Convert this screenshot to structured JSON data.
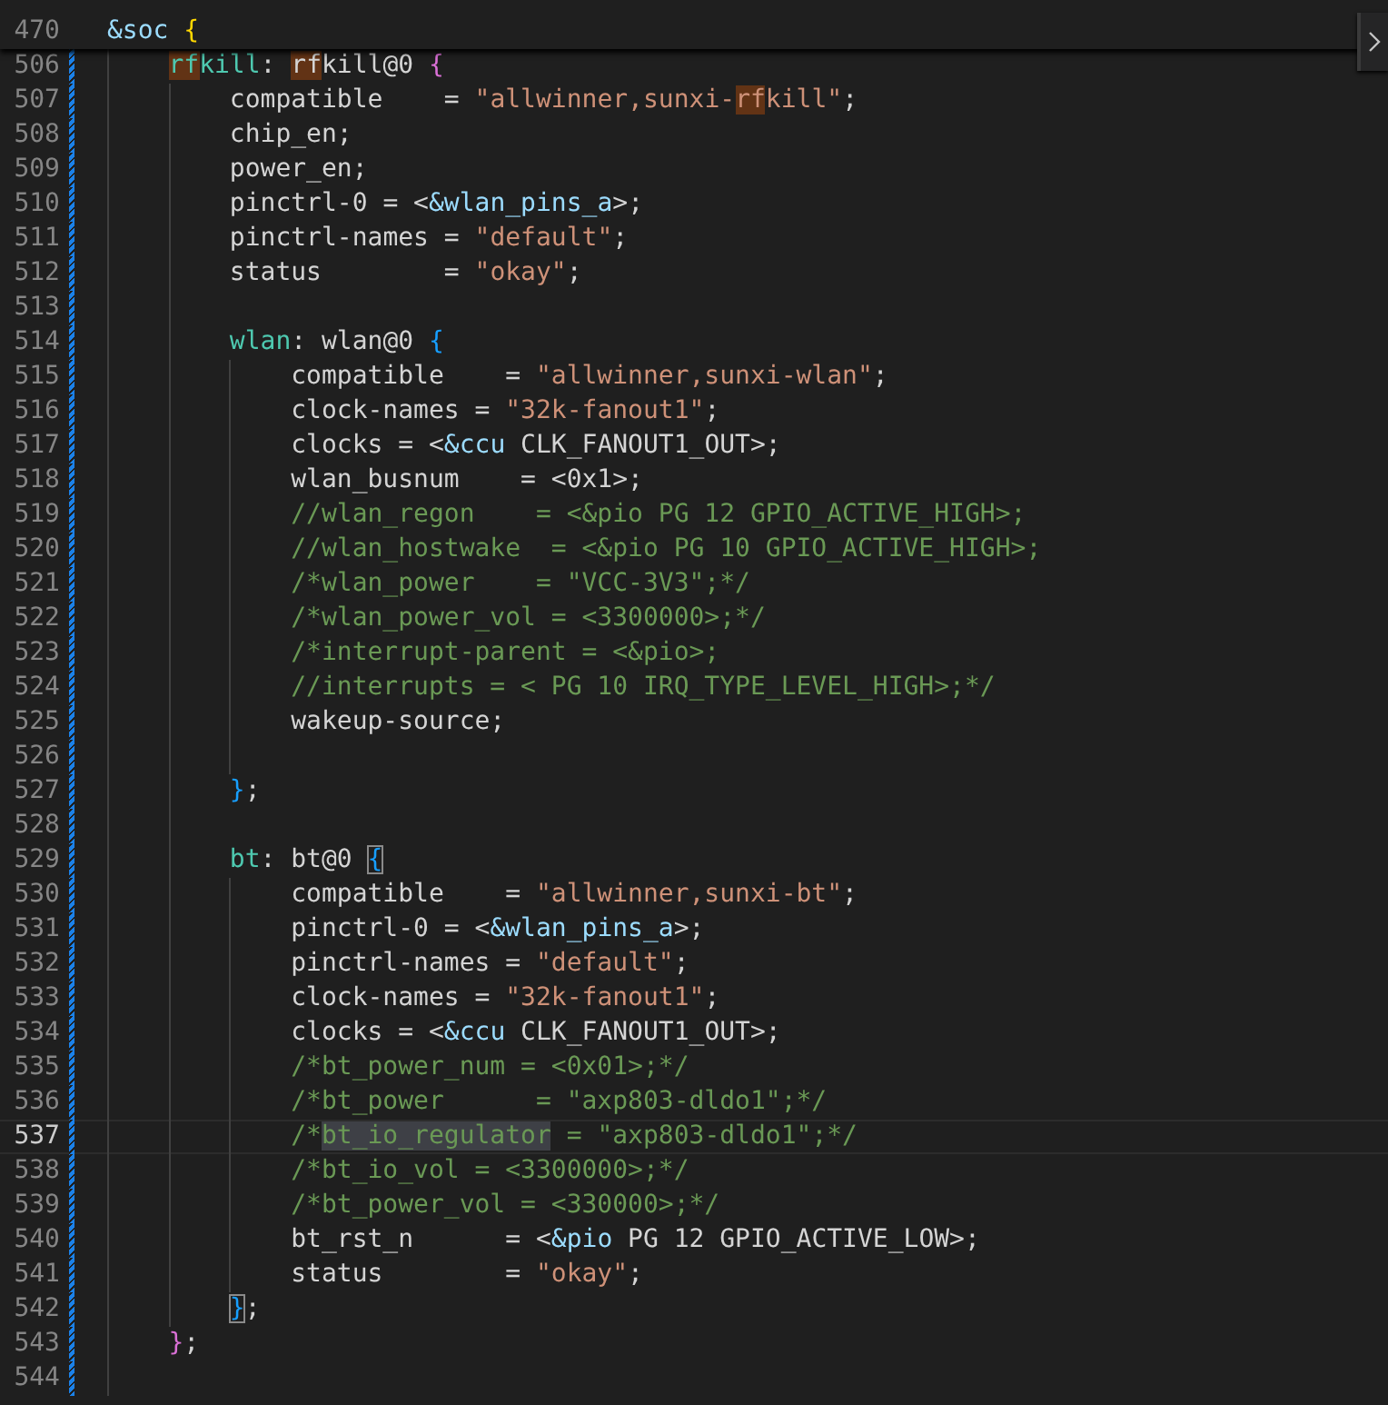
{
  "sticky_scroll": {
    "number": "470",
    "tokens": [
      {
        "text": "&soc ",
        "kind": "ref"
      },
      {
        "text": "{",
        "kind": "bracket",
        "color": "#ffd700"
      }
    ],
    "children": [
      {
        "number": "506",
        "modified": true,
        "tokens": [
          {
            "text": "rf",
            "kind": "label",
            "highlighted": true
          },
          {
            "text": "kill",
            "kind": "label"
          },
          {
            "text": ": ",
            "kind": "plain"
          },
          {
            "text": "rf",
            "kind": "plain",
            "highlighted": true
          },
          {
            "text": "kill@0 ",
            "kind": "plain"
          },
          {
            "text": "{",
            "kind": "bracket",
            "color": "#da70d6"
          }
        ],
        "children": [
          {
            "number": "507",
            "modified": true,
            "tokens": [
              {
                "text": "compatible    = ",
                "kind": "plain"
              },
              {
                "text": "\"allwinner,sunxi-",
                "kind": "string"
              },
              {
                "text": "rf",
                "kind": "string",
                "highlighted": true
              },
              {
                "text": "kill\"",
                "kind": "string"
              },
              {
                "text": ";",
                "kind": "plain"
              }
            ]
          },
          {
            "number": "508",
            "modified": true,
            "tokens": [
              {
                "text": "chip_en;",
                "kind": "plain"
              }
            ]
          },
          {
            "number": "509",
            "modified": true,
            "tokens": [
              {
                "text": "power_en;",
                "kind": "plain"
              }
            ]
          },
          {
            "number": "510",
            "modified": true,
            "tokens": [
              {
                "text": "pinctrl-0 = <",
                "kind": "plain"
              },
              {
                "text": "&wlan_pins_a",
                "kind": "ref"
              },
              {
                "text": ">;",
                "kind": "plain"
              }
            ]
          },
          {
            "number": "511",
            "modified": true,
            "tokens": [
              {
                "text": "pinctrl-names = ",
                "kind": "plain"
              },
              {
                "text": "\"default\"",
                "kind": "string"
              },
              {
                "text": ";",
                "kind": "plain"
              }
            ]
          },
          {
            "number": "512",
            "modified": true,
            "tokens": [
              {
                "text": "status        = ",
                "kind": "plain"
              },
              {
                "text": "\"okay\"",
                "kind": "string"
              },
              {
                "text": ";",
                "kind": "plain"
              }
            ]
          },
          {
            "number": "513",
            "modified": true
          },
          {
            "number": "514",
            "modified": true,
            "tokens": [
              {
                "text": "wlan",
                "kind": "label"
              },
              {
                "text": ": wlan@0 ",
                "kind": "plain"
              },
              {
                "text": "{",
                "kind": "bracket",
                "color": "#179fff"
              }
            ],
            "children": [
              {
                "number": "515",
                "modified": true,
                "tokens": [
                  {
                    "text": "compatible    = ",
                    "kind": "plain"
                  },
                  {
                    "text": "\"allwinner,sunxi-wlan\"",
                    "kind": "string"
                  },
                  {
                    "text": ";",
                    "kind": "plain"
                  }
                ]
              },
              {
                "number": "516",
                "modified": true,
                "tokens": [
                  {
                    "text": "clock-names = ",
                    "kind": "plain"
                  },
                  {
                    "text": "\"32k-fanout1\"",
                    "kind": "string"
                  },
                  {
                    "text": ";",
                    "kind": "plain"
                  }
                ]
              },
              {
                "number": "517",
                "modified": true,
                "tokens": [
                  {
                    "text": "clocks = <",
                    "kind": "plain"
                  },
                  {
                    "text": "&ccu",
                    "kind": "ref"
                  },
                  {
                    "text": " CLK_FANOUT1_OUT>;",
                    "kind": "plain"
                  }
                ]
              },
              {
                "number": "518",
                "modified": true,
                "tokens": [
                  {
                    "text": "wlan_busnum    = <0x1>;",
                    "kind": "plain"
                  }
                ]
              },
              {
                "number": "519",
                "modified": true,
                "tokens": [
                  {
                    "text": "//wlan_regon    = <&pio PG 12 GPIO_ACTIVE_HIGH>;",
                    "kind": "comment"
                  }
                ]
              },
              {
                "number": "520",
                "modified": true,
                "tokens": [
                  {
                    "text": "//wlan_hostwake  = <&pio PG 10 GPIO_ACTIVE_HIGH>;",
                    "kind": "comment"
                  }
                ]
              },
              {
                "number": "521",
                "modified": true,
                "tokens": [
                  {
                    "text": "/*wlan_power    = \"VCC-3V3\";*/",
                    "kind": "comment"
                  }
                ]
              },
              {
                "number": "522",
                "modified": true,
                "tokens": [
                  {
                    "text": "/*wlan_power_vol = <3300000>;*/",
                    "kind": "comment"
                  }
                ]
              },
              {
                "number": "523",
                "modified": true,
                "tokens": [
                  {
                    "text": "/*interrupt-parent = <&pio>;",
                    "kind": "comment"
                  }
                ]
              },
              {
                "number": "524",
                "modified": true,
                "tokens": [
                  {
                    "text": "//interrupts = < PG 10 IRQ_TYPE_LEVEL_HIGH>;*/",
                    "kind": "comment"
                  }
                ]
              },
              {
                "number": "525",
                "modified": true,
                "tokens": [
                  {
                    "text": "wakeup-source;",
                    "kind": "plain"
                  }
                ]
              },
              {
                "number": "526",
                "modified": true
              }
            ]
          },
          {
            "number": "527",
            "modified": true,
            "tokens": [
              {
                "text": "}",
                "kind": "bracket",
                "color": "#179fff"
              },
              {
                "text": ";",
                "kind": "plain"
              }
            ]
          },
          {
            "number": "528",
            "modified": true
          },
          {
            "number": "529",
            "modified": true,
            "tokens": [
              {
                "text": "bt",
                "kind": "label"
              },
              {
                "text": ": bt@0 ",
                "kind": "plain"
              },
              {
                "text": "{",
                "kind": "bracket",
                "color": "#179fff",
                "matched": true
              }
            ],
            "children": [
              {
                "number": "530",
                "modified": true,
                "tokens": [
                  {
                    "text": "compatible    = ",
                    "kind": "plain"
                  },
                  {
                    "text": "\"allwinner,sunxi-bt\"",
                    "kind": "string"
                  },
                  {
                    "text": ";",
                    "kind": "plain"
                  }
                ]
              },
              {
                "number": "531",
                "modified": true,
                "tokens": [
                  {
                    "text": "pinctrl-0 = <",
                    "kind": "plain"
                  },
                  {
                    "text": "&wlan_pins_a",
                    "kind": "ref"
                  },
                  {
                    "text": ">;",
                    "kind": "plain"
                  }
                ]
              },
              {
                "number": "532",
                "modified": true,
                "tokens": [
                  {
                    "text": "pinctrl-names = ",
                    "kind": "plain"
                  },
                  {
                    "text": "\"default\"",
                    "kind": "string"
                  },
                  {
                    "text": ";",
                    "kind": "plain"
                  }
                ]
              },
              {
                "number": "533",
                "modified": true,
                "tokens": [
                  {
                    "text": "clock-names = ",
                    "kind": "plain"
                  },
                  {
                    "text": "\"32k-fanout1\"",
                    "kind": "string"
                  },
                  {
                    "text": ";",
                    "kind": "plain"
                  }
                ]
              },
              {
                "number": "534",
                "modified": true,
                "tokens": [
                  {
                    "text": "clocks = <",
                    "kind": "plain"
                  },
                  {
                    "text": "&ccu",
                    "kind": "ref"
                  },
                  {
                    "text": " CLK_FANOUT1_OUT>;",
                    "kind": "plain"
                  }
                ]
              },
              {
                "number": "535",
                "modified": true,
                "tokens": [
                  {
                    "text": "/*bt_power_num = <0x01>;*/",
                    "kind": "comment"
                  }
                ]
              },
              {
                "number": "536",
                "modified": true,
                "tokens": [
                  {
                    "text": "/*bt_power      = \"axp803-dldo1\";*/",
                    "kind": "comment"
                  }
                ]
              },
              {
                "number": "537",
                "modified": true,
                "current": true,
                "tokens": [
                  {
                    "text": "/*",
                    "kind": "comment"
                  },
                  {
                    "text": "bt_io_regulator",
                    "kind": "comment",
                    "selected": true
                  },
                  {
                    "text": " = \"axp803-dldo1\";*/",
                    "kind": "comment"
                  }
                ]
              },
              {
                "number": "538",
                "modified": true,
                "tokens": [
                  {
                    "text": "/*bt_io_vol = <3300000>;*/",
                    "kind": "comment"
                  }
                ]
              },
              {
                "number": "539",
                "modified": true,
                "tokens": [
                  {
                    "text": "/*bt_power_vol = <330000>;*/",
                    "kind": "comment"
                  }
                ]
              },
              {
                "number": "540",
                "modified": true,
                "tokens": [
                  {
                    "text": "bt_rst_n      = <",
                    "kind": "plain"
                  },
                  {
                    "text": "&pio",
                    "kind": "ref"
                  },
                  {
                    "text": " PG 12 GPIO_ACTIVE_LOW>;",
                    "kind": "plain"
                  }
                ]
              },
              {
                "number": "541",
                "modified": true,
                "tokens": [
                  {
                    "text": "status        = ",
                    "kind": "plain"
                  },
                  {
                    "text": "\"okay\"",
                    "kind": "string"
                  },
                  {
                    "text": ";",
                    "kind": "plain"
                  }
                ]
              }
            ]
          },
          {
            "number": "542",
            "modified": true,
            "tokens": [
              {
                "text": "}",
                "kind": "bracket",
                "color": "#179fff",
                "matched": true
              },
              {
                "text": ";",
                "kind": "plain"
              }
            ]
          }
        ]
      },
      {
        "number": "543",
        "modified": true,
        "tokens": [
          {
            "text": "}",
            "kind": "bracket",
            "color": "#da70d6"
          },
          {
            "text": ";",
            "kind": "plain"
          }
        ]
      },
      {
        "number": "544",
        "modified": true
      }
    ]
  }
}
